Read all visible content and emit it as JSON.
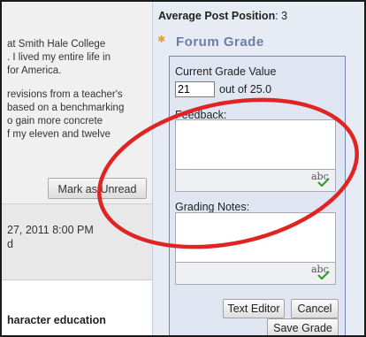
{
  "left": {
    "excerpt_1": [
      "at Smith Hale College",
      ". I lived my entire life in",
      "for America."
    ],
    "excerpt_2": [
      "revisions from a teacher's",
      "based on a benchmarking",
      "o gain more concrete",
      "f my eleven and twelve"
    ],
    "mark_unread_label": "Mark as Unread",
    "post2_date": "27, 2011 8:00 PM",
    "post2_author": "d",
    "post3_title": "haracter education"
  },
  "sidebar": {
    "avg_label": "Average Post Position",
    "avg_value": ": 3",
    "forum_grade_title": "Forum Grade",
    "current_grade_label": "Current Grade Value",
    "grade_value": "21",
    "out_of": "out of 25.0",
    "feedback_label": "Feedback:",
    "grading_notes_label": "Grading Notes:",
    "spellcheck_text": "abc",
    "text_editor_label": "Text Editor",
    "cancel_label": "Cancel",
    "save_grade_label": "Save Grade"
  },
  "icons": {
    "star": "star-icon",
    "spellcheck": "spellcheck-icon"
  },
  "colors": {
    "annotation": "#e02424",
    "panel_border": "#7488b8",
    "title": "#6a7fa6",
    "sidebar_bg": "#e7ecf4"
  }
}
